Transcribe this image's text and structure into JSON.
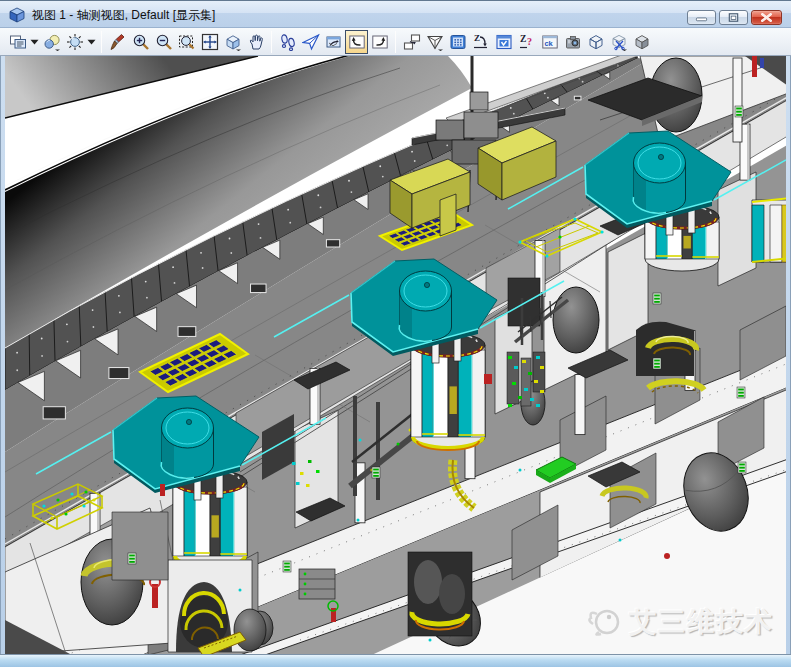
{
  "window": {
    "title": "视图 1 - 轴测视图, Default [显示集]",
    "icon": "view-cube-icon",
    "controls": [
      {
        "name": "minimize",
        "icon": "minimize-icon"
      },
      {
        "name": "maximize",
        "icon": "maximize-icon"
      },
      {
        "name": "close",
        "icon": "close-icon"
      }
    ]
  },
  "toolbar": {
    "buttons": [
      {
        "icon": "view-display-mode-icon",
        "dropdown": "arrow"
      },
      {
        "icon": "display-style-icon",
        "dropdown": "mini"
      },
      {
        "icon": "view-brightness-icon",
        "dropdown": "arrow"
      },
      {
        "separator": true
      },
      {
        "icon": "update-view-icon"
      },
      {
        "icon": "zoom-in-icon"
      },
      {
        "icon": "zoom-out-icon"
      },
      {
        "icon": "window-area-icon"
      },
      {
        "icon": "fit-view-icon"
      },
      {
        "icon": "rotate-view-icon",
        "dropdown": "mini"
      },
      {
        "icon": "pan-view-icon"
      },
      {
        "separator": true
      },
      {
        "icon": "walk-icon"
      },
      {
        "icon": "fly-icon"
      },
      {
        "icon": "navigate-view-icon"
      },
      {
        "icon": "view-previous-icon",
        "active": true
      },
      {
        "icon": "view-next-icon"
      },
      {
        "separator": true
      },
      {
        "icon": "copy-view-icon"
      },
      {
        "icon": "clip-volume-icon",
        "dropdown": "mini"
      },
      {
        "icon": "clip-mask-icon"
      },
      {
        "icon": "change-view-perspective-icon"
      },
      {
        "icon": "saved-views-icon"
      },
      {
        "icon": "query-view-icon"
      },
      {
        "icon": "view-controls-icon"
      },
      {
        "icon": "camera-icon"
      },
      {
        "icon": "wireframe-cube-icon"
      },
      {
        "icon": "clip-cube-icon",
        "dropdown": "mini"
      },
      {
        "icon": "shaded-cube-icon"
      }
    ]
  },
  "viewport": {
    "watermark": {
      "text": "艾三维技术",
      "logo": "fish-logo-icon"
    },
    "scene_description": "Isometric 3D CAD view of a ship hull block: gray decks cut open in steps, three teal octagonal winch platforms with cylinders, yellow equipment pallets, containers and machinery, white structural walls with oval lightening holes."
  },
  "colors": {
    "titlebar_top": "#eaf2fb",
    "titlebar_bottom": "#bdd2ea",
    "frame_blue": "#b8d4ec",
    "close_red": "#cc4433",
    "toolbar_bg": "#eef2f7",
    "active_button_bg": "#f6d68c",
    "deck_gray": "#8d8d8d",
    "hull_dark": "#2a2a2a",
    "teal": "#00939b",
    "teal_bright": "#54f0f0",
    "equipment_khaki": "#b6b63a",
    "pallet_blue": "#1c1c7e",
    "machinery_yellow": "#e0e000",
    "background": "#ffffff"
  }
}
